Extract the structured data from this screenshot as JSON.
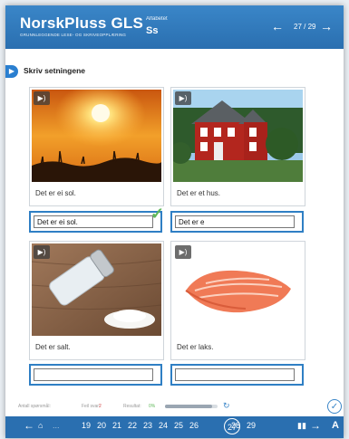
{
  "header": {
    "brand": "NorskPluss GLS",
    "brand_sub": "GRUNNLEGGENDE LESE- OG SKRIVEOPPLÆRING",
    "section_small": "Alfabetet",
    "section_big": "Ss",
    "page_counter": "27 / 29",
    "prev_icon": "arrow-left-icon",
    "next_icon": "arrow-right-icon"
  },
  "instruction": {
    "title": "Skriv setningene"
  },
  "cards": [
    {
      "caption": "Det er ei sol.",
      "answer": "Det er ei sol.",
      "correct": true,
      "image": "sun"
    },
    {
      "caption": "Det er et hus.",
      "answer": "Det er e",
      "correct": false,
      "image": "house"
    },
    {
      "caption": "Det er salt.",
      "answer": "",
      "correct": false,
      "image": "salt"
    },
    {
      "caption": "Det er laks.",
      "answer": "",
      "correct": false,
      "image": "salmon"
    }
  ],
  "status": {
    "answered_label": "Antall spørsmål:",
    "errors_label": "Feil svar:",
    "errors_value": "2",
    "score_label": "Resultat:",
    "score_value": "0%",
    "progress": 0.9
  },
  "footer": {
    "pages": [
      "19",
      "20",
      "21",
      "22",
      "23",
      "24",
      "25",
      "26",
      "27",
      "28",
      "29"
    ],
    "current": "27",
    "text_tool": "A"
  },
  "colors": {
    "primary": "#2a6fb0",
    "accent_border": "#2f7fc4",
    "correct": "#5fb85a"
  }
}
